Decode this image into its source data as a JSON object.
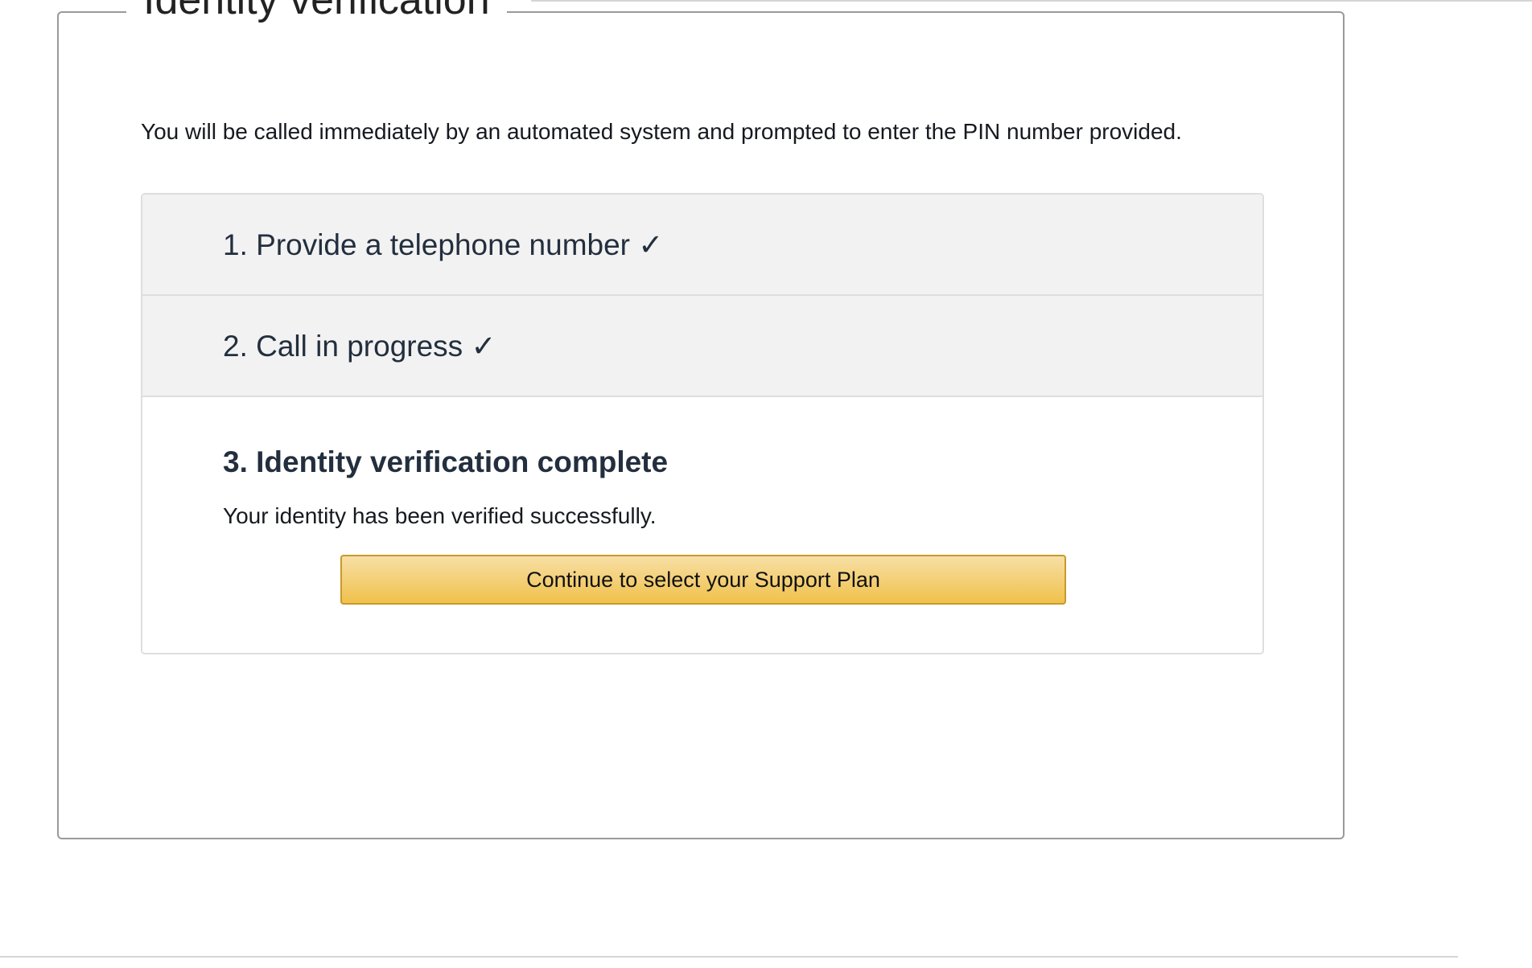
{
  "fieldset": {
    "legend": "Identity verification",
    "intro": "You will be called immediately by an automated system and prompted to enter the PIN number provided."
  },
  "steps": [
    {
      "label": "1. Provide a telephone number ✓"
    },
    {
      "label": "2. Call in progress ✓"
    },
    {
      "label": "3. Identity verification complete",
      "message": "Your identity has been verified successfully.",
      "button_label": "Continue to select your Support Plan"
    }
  ],
  "colors": {
    "button": "#f0c14b",
    "heading": "#232f3e",
    "step_background": "#f2f2f2"
  }
}
